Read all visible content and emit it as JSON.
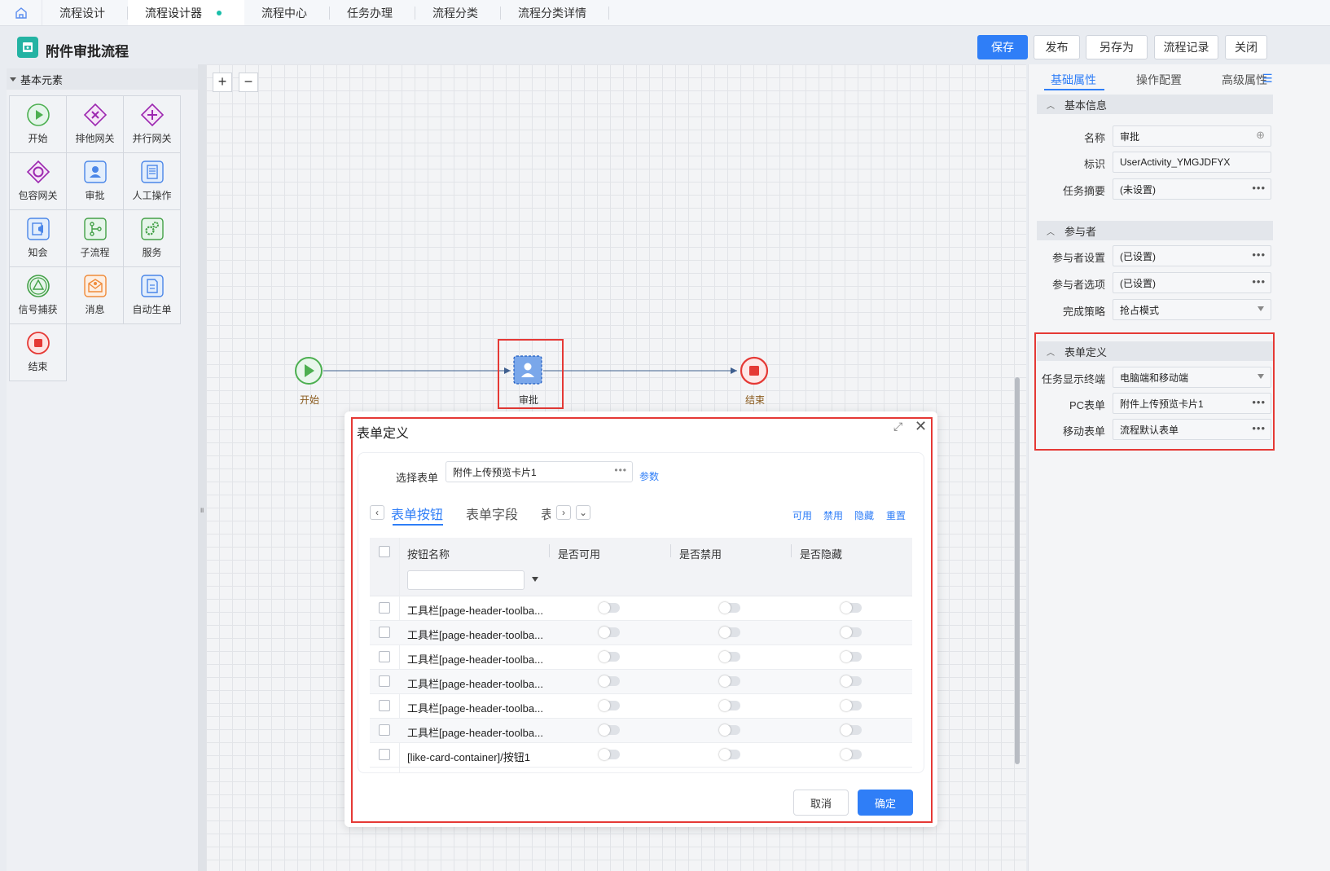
{
  "tabs": [
    {
      "label": "流程设计"
    },
    {
      "label": "流程设计器"
    },
    {
      "label": "流程中心"
    },
    {
      "label": "任务办理"
    },
    {
      "label": "流程分类"
    },
    {
      "label": "流程分类详情"
    }
  ],
  "header": {
    "title": "附件审批流程",
    "buttons": {
      "save": "保存",
      "publish": "发布",
      "save_as": "另存为",
      "records": "流程记录",
      "close": "关闭"
    }
  },
  "palette": {
    "section": "基本元素",
    "items": [
      {
        "label": "开始",
        "icon": "start-icon"
      },
      {
        "label": "排他网关",
        "icon": "exclusive-gateway-icon"
      },
      {
        "label": "并行网关",
        "icon": "parallel-gateway-icon"
      },
      {
        "label": "包容网关",
        "icon": "inclusive-gateway-icon"
      },
      {
        "label": "审批",
        "icon": "approval-icon"
      },
      {
        "label": "人工操作",
        "icon": "manual-task-icon"
      },
      {
        "label": "知会",
        "icon": "notify-icon"
      },
      {
        "label": "子流程",
        "icon": "subprocess-icon"
      },
      {
        "label": "服务",
        "icon": "service-icon"
      },
      {
        "label": "信号捕获",
        "icon": "signal-catch-icon"
      },
      {
        "label": "消息",
        "icon": "message-icon"
      },
      {
        "label": "自动生单",
        "icon": "auto-order-icon"
      },
      {
        "label": "结束",
        "icon": "end-icon"
      }
    ]
  },
  "canvas": {
    "nodes": {
      "start": "开始",
      "approval": "审批",
      "end": "结束"
    }
  },
  "right_panel": {
    "tabs": [
      "基础属性",
      "操作配置",
      "高级属性"
    ],
    "basic": {
      "title": "基本信息",
      "name_label": "名称",
      "name_value": "审批",
      "id_label": "标识",
      "id_value": "UserActivity_YMGJDFYX",
      "summary_label": "任务摘要",
      "summary_value": "(未设置)"
    },
    "participants": {
      "title": "参与者",
      "setting_label": "参与者设置",
      "setting_value": "(已设置)",
      "options_label": "参与者选项",
      "options_value": "(已设置)",
      "strategy_label": "完成策略",
      "strategy_value": "抢占模式"
    },
    "form": {
      "title": "表单定义",
      "terminal_label": "任务显示终端",
      "terminal_value": "电脑端和移动端",
      "pc_label": "PC表单",
      "pc_value": "附件上传预览卡片1",
      "mobile_label": "移动表单",
      "mobile_value": "流程默认表单"
    }
  },
  "dialog": {
    "title": "表单定义",
    "select_label": "选择表单",
    "select_value": "附件上传预览卡片1",
    "param_link": "参数",
    "subtabs": [
      "表单按钮",
      "表单字段",
      "表"
    ],
    "actions": [
      "可用",
      "禁用",
      "隐藏",
      "重置"
    ],
    "columns": [
      "按钮名称",
      "是否可用",
      "是否禁用",
      "是否隐藏"
    ],
    "rows": [
      {
        "name": "工具栏[page-header-toolba..."
      },
      {
        "name": "工具栏[page-header-toolba..."
      },
      {
        "name": "工具栏[page-header-toolba..."
      },
      {
        "name": "工具栏[page-header-toolba..."
      },
      {
        "name": "工具栏[page-header-toolba..."
      },
      {
        "name": "工具栏[page-header-toolba..."
      },
      {
        "name": "[like-card-container]/按钮1"
      }
    ],
    "cancel": "取消",
    "ok": "确定"
  },
  "colors": {
    "accent": "#2f7ef7",
    "highlight": "#e53935",
    "brand": "#24b3a3"
  }
}
